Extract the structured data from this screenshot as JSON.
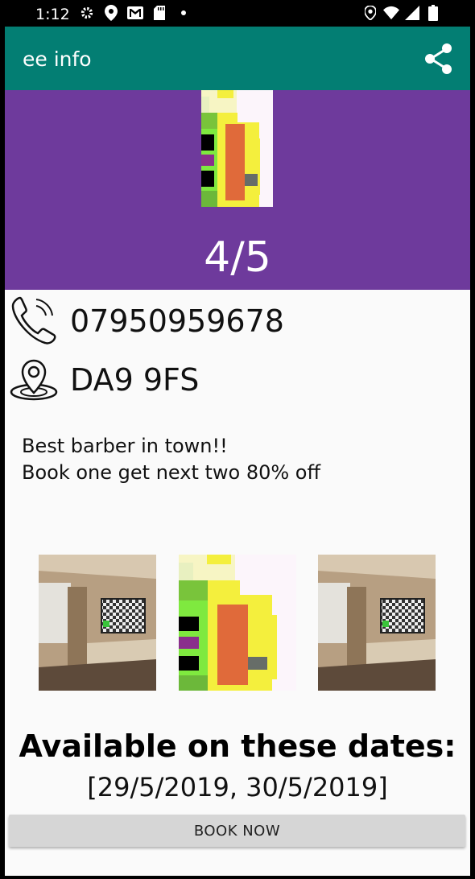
{
  "status_bar": {
    "time": "1:12",
    "left_icons": [
      "gear-icon",
      "location-icon",
      "gmail-icon",
      "sd-card-icon",
      "dot-icon"
    ],
    "right_icons": [
      "location-icon",
      "wifi-icon",
      "signal-icon",
      "battery-icon"
    ]
  },
  "app_bar": {
    "title": "ee info",
    "share_icon": "share-icon",
    "color": "#037e73"
  },
  "hero": {
    "background": "#6e3a9c",
    "rating": "4/5"
  },
  "contact": {
    "phone": "07950959678",
    "postcode": "DA9 9FS"
  },
  "description": {
    "line1": "Best barber in town!!",
    "line2": "Book one get next two 80% off"
  },
  "gallery": [
    "room-photo",
    "pixel-art-image",
    "room-photo"
  ],
  "availability": {
    "title": "Available on these dates:",
    "dates": "[29/5/2019, 30/5/2019]"
  },
  "book_button": {
    "label": "BOOK NOW"
  }
}
